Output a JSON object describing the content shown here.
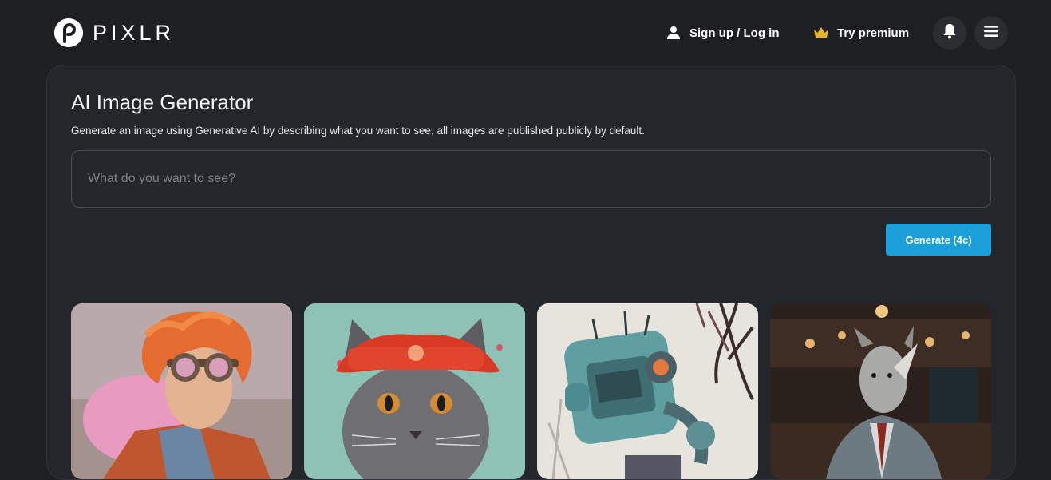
{
  "header": {
    "logo_text": "PIXLR",
    "signin_label": "Sign up / Log in",
    "premium_label": "Try premium",
    "icons": {
      "user": "user-icon",
      "crown": "crown-icon",
      "bell": "bell-icon",
      "menu": "hamburger-menu-icon"
    },
    "crown_color": "#e9b526"
  },
  "main": {
    "title": "AI Image Generator",
    "description": "Generate an image using Generative AI by describing what you want to see, all images are published publicly by default.",
    "prompt_placeholder": "What do you want to see?",
    "prompt_value": "",
    "generate_label": "Generate (4c)",
    "accent_color": "#1b9fd8"
  },
  "gallery": {
    "items": [
      {
        "subject": "steampunk-goggles-portrait"
      },
      {
        "subject": "cat-with-red-hat"
      },
      {
        "subject": "robot-illustration"
      },
      {
        "subject": "rhino-in-suit-bar"
      }
    ]
  }
}
